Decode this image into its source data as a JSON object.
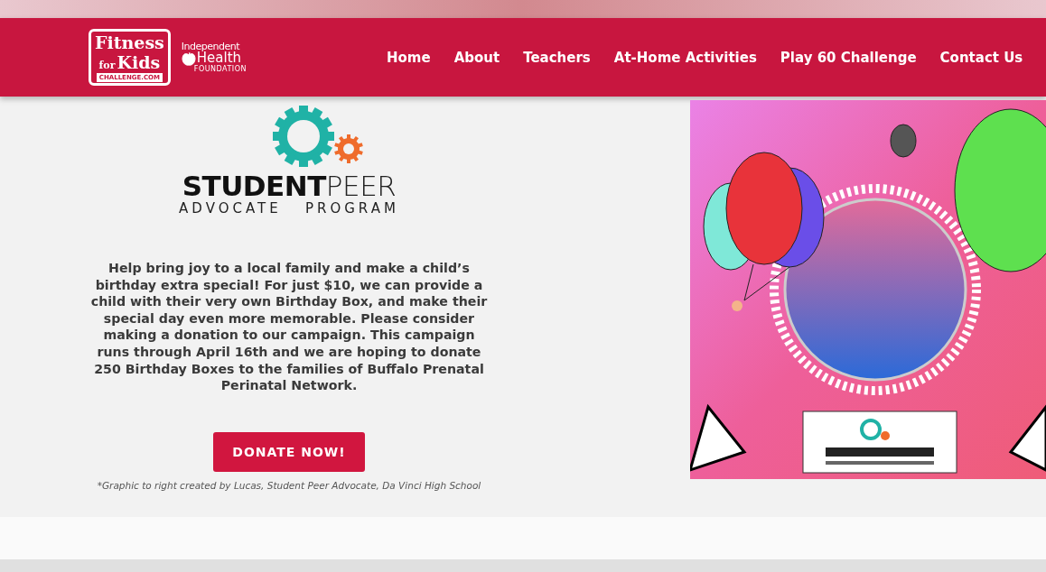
{
  "header": {
    "logo": {
      "line_1": "Fitness",
      "line_2": "for",
      "line_3": "Kids",
      "line_4": "CHALLENGE.COM"
    },
    "partner_logo": {
      "line_1": "Independent",
      "line_2": "Health",
      "line_3": "FOUNDATION"
    },
    "nav": [
      {
        "label": "Home"
      },
      {
        "label": "About"
      },
      {
        "label": "Teachers"
      },
      {
        "label": "At-Home Activities"
      },
      {
        "label": "Play 60 Challenge"
      },
      {
        "label": "Contact Us"
      }
    ]
  },
  "program_logo": {
    "bold": "STUDENT",
    "light": "PEER",
    "subtitle": "ADVOCATE   PROGRAM"
  },
  "body": "Help bring joy to a local family and make a child’s birthday extra special! For just $10, we can provide a child with their very own Birthday Box, and make their special day even more memorable. Please consider making a donation to our campaign. This campaign runs through April 16th and we are hoping to donate 250 Birthday Boxes to the families of Buffalo Prenatal Perinatal Network.",
  "button": "DONATE NOW!",
  "caption": "*Graphic to right created by Lucas, Student Peer Advocate, Da Vinci High School"
}
